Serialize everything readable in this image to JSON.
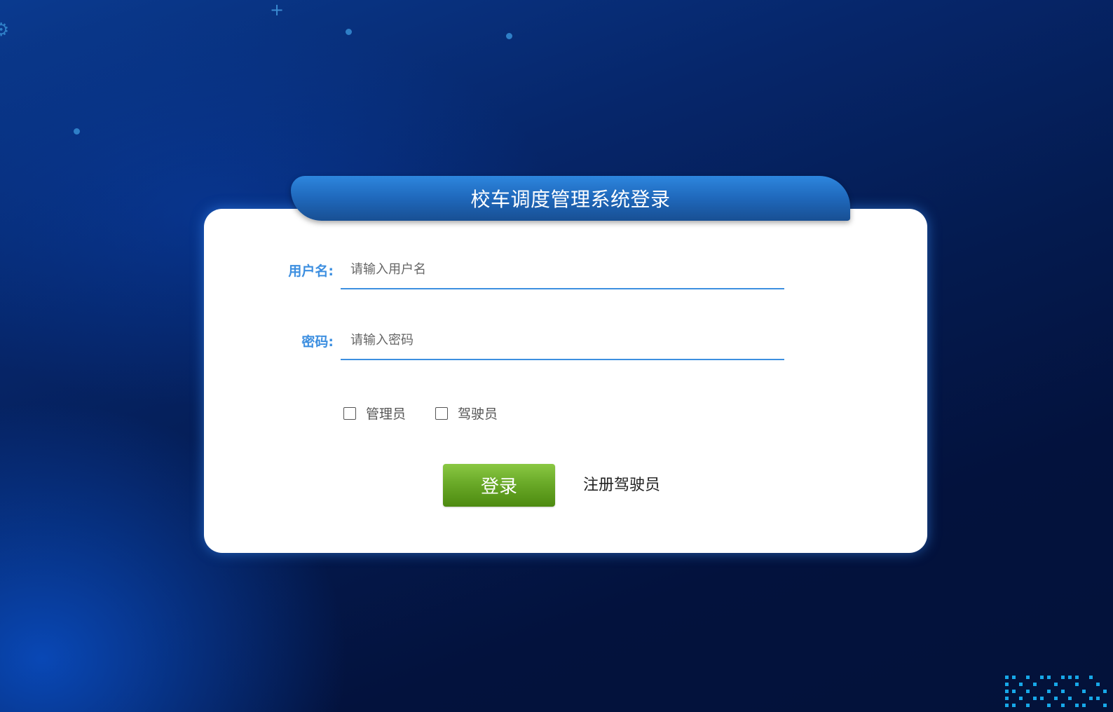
{
  "header": {
    "title": "校车调度管理系统登录"
  },
  "form": {
    "username": {
      "label": "用户名:",
      "placeholder": "请输入用户名",
      "value": ""
    },
    "password": {
      "label": "密码:",
      "placeholder": "请输入密码",
      "value": ""
    },
    "roles": [
      {
        "label": "管理员",
        "checked": false
      },
      {
        "label": "驾驶员",
        "checked": false
      }
    ],
    "login_label": "登录",
    "register_label": "注册驾驶员"
  },
  "colors": {
    "accent": "#3d8fe0",
    "login_button": "#6aaa28",
    "header_tab": "#1f68bb",
    "background": "#041a4e"
  },
  "icons": {
    "decor": [
      "gear-icon",
      "plus-icon",
      "dot-icon",
      "pixel-pattern"
    ]
  }
}
